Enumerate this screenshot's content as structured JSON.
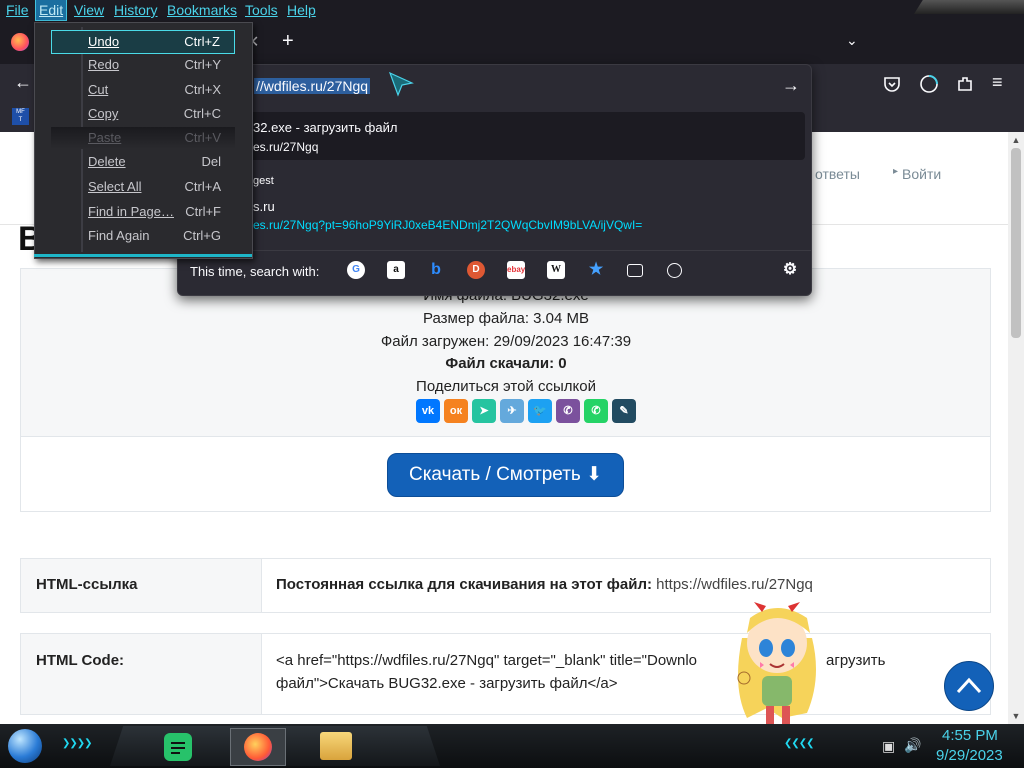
{
  "menubar": {
    "items": [
      {
        "label": "File"
      },
      {
        "label": "Edit"
      },
      {
        "label": "View"
      },
      {
        "label": "History"
      },
      {
        "label": "Bookmarks"
      },
      {
        "label": "Tools"
      },
      {
        "label": "Help"
      }
    ]
  },
  "edit_menu": {
    "items": [
      {
        "label": "Undo",
        "shortcut": "Ctrl+Z"
      },
      {
        "label": "Redo",
        "shortcut": "Ctrl+Y"
      },
      {
        "label": "Cut",
        "shortcut": "Ctrl+X"
      },
      {
        "label": "Copy",
        "shortcut": "Ctrl+C"
      },
      {
        "label": "Paste",
        "shortcut": "Ctrl+V"
      },
      {
        "label": "Delete",
        "shortcut": "Del"
      },
      {
        "label": "Select All",
        "shortcut": "Ctrl+A"
      },
      {
        "label": "Find in Page…",
        "shortcut": "Ctrl+F"
      },
      {
        "label": "Find Again",
        "shortcut": "Ctrl+G"
      }
    ]
  },
  "urlbar": {
    "value": "//wdfiles.ru/27Ngq",
    "suggestions": [
      {
        "title": "32.exe - загрузить файл",
        "url": "es.ru/27Ngq"
      },
      {
        "title": "gest",
        "url": ""
      },
      {
        "title": "s.ru",
        "url": "es.ru/27Ngq?pt=96hoP9YiRJ0xeB4ENDmj2T2QWqCbvIM9bLVA/ijVQwI="
      }
    ],
    "search_with_label": "This time, search with:",
    "engines": [
      "google-icon",
      "amazon-icon",
      "bing-icon",
      "duckduckgo-icon",
      "ebay-icon",
      "wikipedia-icon",
      "bookmarks-icon",
      "tabs-icon",
      "history-icon"
    ]
  },
  "site_nav": {
    "answers": "ответы",
    "login": "Войти"
  },
  "page_heading_partial": "B",
  "file_info": {
    "name_line": "Имя файла: BUG32.exe",
    "size_line": "Размер файла: 3.04 MB",
    "uploaded_line": "Файл загружен: 29/09/2023 16:47:39",
    "downloads_line": "Файл скачали: 0",
    "share_label": "Поделиться этой ссылкой"
  },
  "share_buttons": [
    {
      "name": "vk-share-icon",
      "glyph": "vk",
      "color": "#0077ff"
    },
    {
      "name": "ok-share-icon",
      "glyph": "ок",
      "color": "#f58220"
    },
    {
      "name": "mail-share-icon",
      "glyph": "➤",
      "color": "#26c4a0"
    },
    {
      "name": "telegram-share-icon",
      "glyph": "✈",
      "color": "#64a9dc"
    },
    {
      "name": "twitter-share-icon",
      "glyph": "🐦",
      "color": "#1da1f2"
    },
    {
      "name": "viber-share-icon",
      "glyph": "✆",
      "color": "#7b519d"
    },
    {
      "name": "whatsapp-share-icon",
      "glyph": "✆",
      "color": "#25d366"
    },
    {
      "name": "livejournal-share-icon",
      "glyph": "✎",
      "color": "#224b61"
    }
  ],
  "download_button": {
    "label": "Скачать / Смотреть",
    "icon": "download-icon"
  },
  "rows": [
    {
      "key": "HTML-ссылка",
      "value_bold": "Постоянная ссылка для скачивания на этот файл:",
      "value": " https://wdfiles.ru/27Ngq"
    },
    {
      "key": "HTML Code:",
      "value_line1": "<a href=\"https://wdfiles.ru/27Ngq\" target=\"_blank\" title=\"Downlo",
      "value_line1_tail": "агрузить",
      "value_line2": "файл\">Скачать BUG32.exe - загрузить файл</a>"
    }
  ],
  "taskbar": {
    "time": "4:55 PM",
    "date": "9/29/2023"
  },
  "colors": {
    "accent": "#4ad3ea",
    "download_button": "#1361b8",
    "page_bg": "#ffffff",
    "chrome_bg": "#2b2a33"
  }
}
